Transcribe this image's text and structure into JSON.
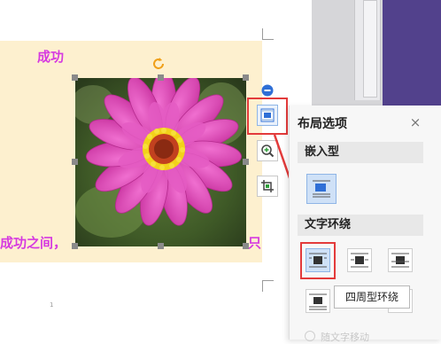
{
  "document": {
    "text_top": "成功",
    "text_left": "成功之间，",
    "text_right": "只",
    "page_number": "1"
  },
  "image_toolbar": {
    "layout_button": "layout-options",
    "zoom_button": "zoom",
    "crop_button": "crop"
  },
  "layout_panel": {
    "title": "布局选项",
    "close": "×",
    "inline_section": "嵌入型",
    "wrap_section": "文字环绕",
    "tooltip": "四周型环绕",
    "bottom_option": "随文字移动"
  },
  "colors": {
    "doc_text": "#d63ae0",
    "highlight_red": "#e33b3b",
    "purple_bg": "#52418c"
  }
}
